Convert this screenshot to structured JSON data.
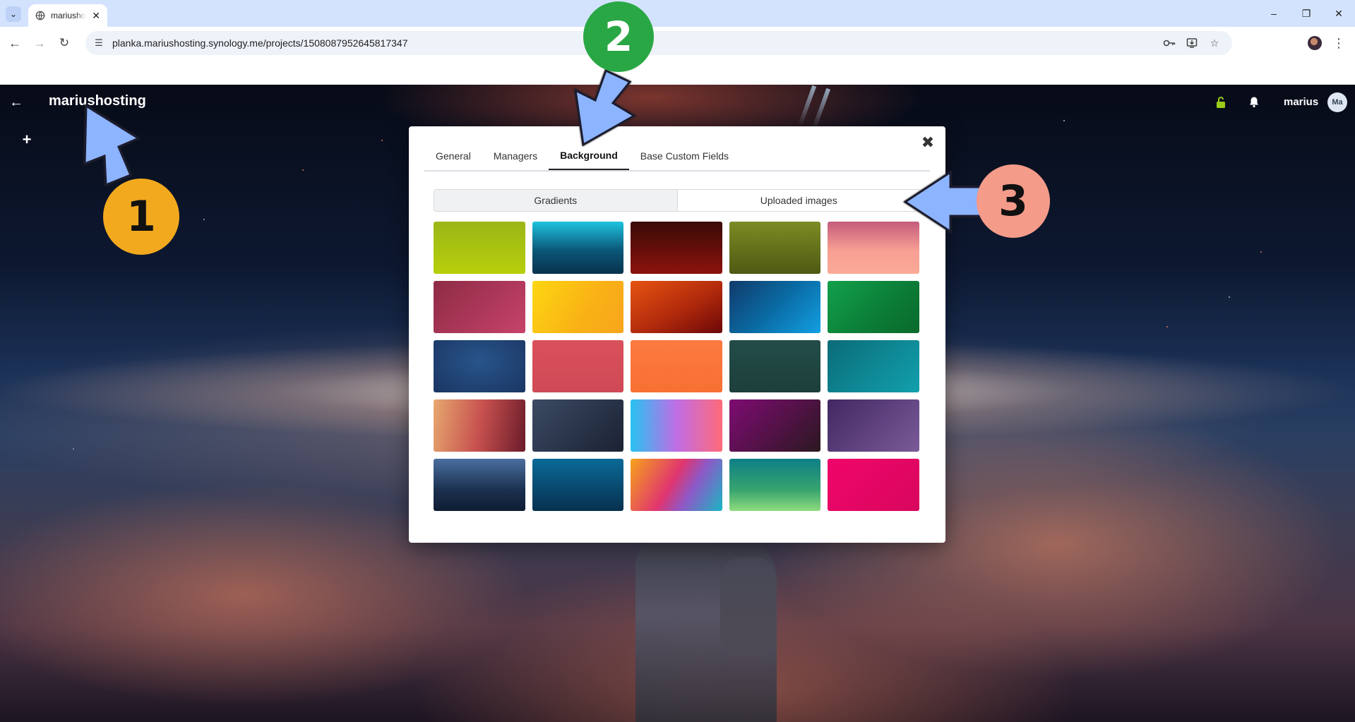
{
  "browser": {
    "tab_title": "mariushosting",
    "url": "planka.mariushosting.synology.me/projects/1508087952645817347"
  },
  "header": {
    "project_name": "mariushosting",
    "user_name": "marius",
    "user_initials": "Ma"
  },
  "modal": {
    "tabs": [
      {
        "label": "General",
        "active": false
      },
      {
        "label": "Managers",
        "active": false
      },
      {
        "label": "Background",
        "active": true
      },
      {
        "label": "Base Custom Fields",
        "active": false
      }
    ],
    "background_types": [
      {
        "label": "Gradients",
        "active": true
      },
      {
        "label": "Uploaded images",
        "active": false
      }
    ],
    "gradients": [
      "linear-gradient(180deg,#9bb618,#b7cf0a)",
      "linear-gradient(180deg,#1ec3df 0%,#0b5778 55%,#07324d 100%)",
      "linear-gradient(180deg,#3a0b07,#8d120c)",
      "linear-gradient(180deg,#7d8b24,#4f5912)",
      "linear-gradient(180deg,#c45c7c 0%,#f79f93 55%,#fbaa96 100%)",
      "linear-gradient(135deg,#8e2b45,#c6436a)",
      "linear-gradient(120deg,#fdd612,#f9b115 60%,#f7a51d)",
      "linear-gradient(150deg,#e65311,#b12a0c 55%,#6c0707)",
      "linear-gradient(135deg,#113a6b,#0a6ba3 50%,#139fe3)",
      "linear-gradient(135deg,#12a04b,#0b7c36 60%,#0a6a2b)",
      "radial-gradient(ellipse at 50% 40%,#28558a,#1a3563)",
      "linear-gradient(180deg,#d9515b,#cf4956)",
      "linear-gradient(180deg,#fc7a40,#f87033)",
      "linear-gradient(180deg,#234c48,#1d3f3b)",
      "linear-gradient(135deg,#0b6b78,#12a0ad)",
      "linear-gradient(100deg,#e7a86f,#c7514f 50%,#6b1b2a)",
      "linear-gradient(135deg,#3b4a63,#1b2233)",
      "linear-gradient(90deg,#27c3f1,#c06de5 50%,#fe6a7a)",
      "linear-gradient(135deg,#7f0b73,#2b1820)",
      "linear-gradient(135deg,#412763,#7a5b98)",
      "linear-gradient(180deg,#4a6e9f,#1b304f 60%,#0e1c33)",
      "linear-gradient(180deg,#0a6a98,#07304f)",
      "linear-gradient(120deg,#f6a21b,#e0356f 45%,#8e58c7 65%,#1ab6c3)",
      "linear-gradient(180deg,#0d7f86,#38a46f 60%,#8fdc7d)",
      "linear-gradient(135deg,#f0056a,#d8075e)"
    ]
  },
  "annotations": [
    "1",
    "2",
    "3"
  ],
  "colors": {
    "unlocked_icon": "#9acd18",
    "badge_1": "#f2a91e",
    "badge_2": "#2aa745",
    "badge_3": "#f59b8a",
    "arrow": "#8db4ff"
  }
}
